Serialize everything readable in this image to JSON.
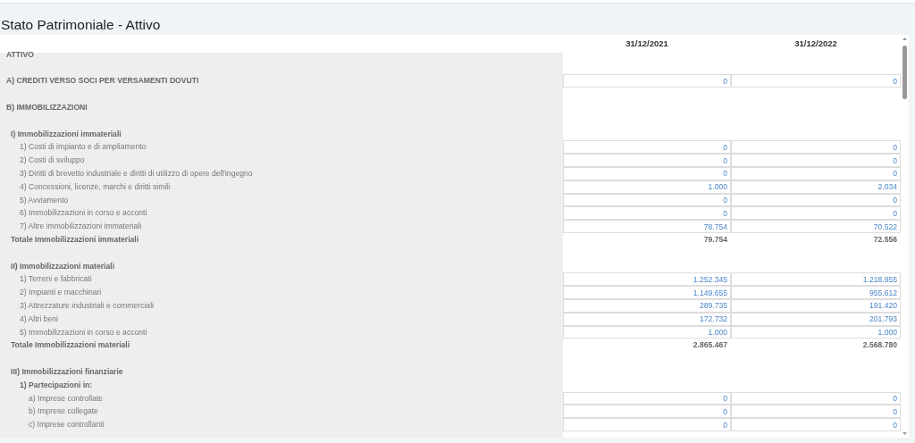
{
  "title": "Stato Patrimoniale - Attivo",
  "columns": [
    "31/12/2021",
    "31/12/2022"
  ],
  "rows": [
    {
      "kind": "section",
      "label": "ATTIVO"
    },
    {
      "kind": "section",
      "label": "A) CREDITI VERSO SOCI PER VERSAMENTI DOVUTI",
      "values": [
        "0",
        "0"
      ]
    },
    {
      "kind": "section",
      "label": "B) IMMOBILIZZAZIONI",
      "children": [
        {
          "kind": "group",
          "label": "I) Immobilizzazioni immateriali",
          "children": [
            {
              "kind": "item",
              "label": "1) Costi di impianto e di ampliamento",
              "values": [
                "0",
                "0"
              ]
            },
            {
              "kind": "item",
              "label": "2) Costi di sviluppo",
              "values": [
                "0",
                "0"
              ]
            },
            {
              "kind": "item",
              "label": "3) Diritti di brevetto industriale e diritti di utilizzo di opere dell'ingegno",
              "values": [
                "0",
                "0"
              ]
            },
            {
              "kind": "item",
              "label": "4) Concessioni, licenze, marchi e diritti simili",
              "values": [
                "1.000",
                "2.034"
              ]
            },
            {
              "kind": "item",
              "label": "5) Avviamento",
              "values": [
                "0",
                "0"
              ]
            },
            {
              "kind": "item",
              "label": "6) Immobilizzazioni in corso e acconti",
              "values": [
                "0",
                "0"
              ]
            },
            {
              "kind": "item",
              "label": "7) Altre immobilizzazioni immateriali",
              "values": [
                "78.754",
                "70.522"
              ]
            }
          ]
        },
        {
          "kind": "total",
          "label": "Totale Immobilizzazioni immateriali",
          "values": [
            "79.754",
            "72.556"
          ]
        },
        {
          "kind": "group",
          "label": "II) Immobilizzazioni materiali",
          "children": [
            {
              "kind": "item",
              "label": "1) Terreni e fabbricati",
              "values": [
                "1.252.345",
                "1.218.955"
              ]
            },
            {
              "kind": "item",
              "label": "2) Impianti e macchinari",
              "values": [
                "1.149.655",
                "955.612"
              ]
            },
            {
              "kind": "item",
              "label": "3) Attrezzature industriali e commerciali",
              "values": [
                "289.735",
                "191.420"
              ]
            },
            {
              "kind": "item",
              "label": "4) Altri beni",
              "values": [
                "172.732",
                "201.793"
              ]
            },
            {
              "kind": "item",
              "label": "5) Immobilizzazioni in corso e acconti",
              "values": [
                "1.000",
                "1.000"
              ]
            }
          ]
        },
        {
          "kind": "total",
          "label": "Totale Immobilizzazioni materiali",
          "values": [
            "2.865.467",
            "2.568.780"
          ]
        },
        {
          "kind": "group",
          "label": "III) Immobilizzazioni finanziarie",
          "children": [
            {
              "kind": "group",
              "label": "1) Partecipazioni in:",
              "children": [
                {
                  "kind": "item",
                  "label": "a) Imprese controllate",
                  "values": [
                    "0",
                    "0"
                  ]
                },
                {
                  "kind": "item",
                  "label": "b) Imprese collegate",
                  "values": [
                    "0",
                    "0"
                  ]
                },
                {
                  "kind": "item",
                  "label": "c) Imprese controllanti",
                  "values": [
                    "0",
                    "0"
                  ]
                }
              ]
            }
          ]
        }
      ]
    }
  ]
}
